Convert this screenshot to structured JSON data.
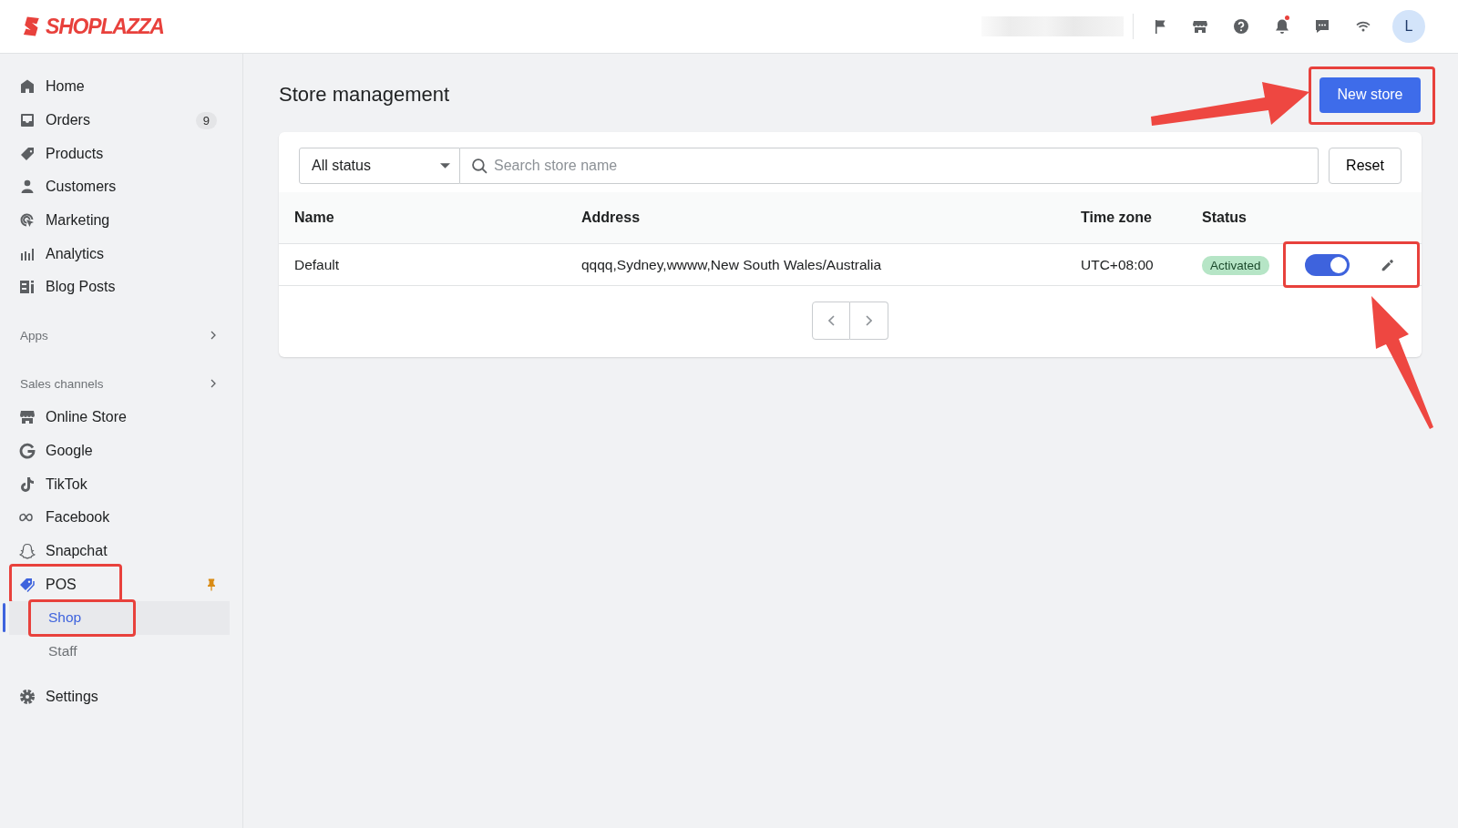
{
  "header": {
    "logo": "SHOPLAZZA",
    "avatar_initial": "L",
    "unread_notifications": true
  },
  "sidebar": {
    "items": [
      {
        "kind": "item",
        "label": "Home",
        "selected": false
      },
      {
        "kind": "item",
        "label": "Orders",
        "badge": "9",
        "selected": false
      },
      {
        "kind": "item",
        "label": "Products",
        "selected": false
      },
      {
        "kind": "item",
        "label": "Customers",
        "selected": false
      },
      {
        "kind": "item",
        "label": "Marketing",
        "selected": false
      },
      {
        "kind": "item",
        "label": "Analytics",
        "selected": false
      },
      {
        "kind": "item",
        "label": "Blog Posts",
        "selected": false
      },
      {
        "kind": "section",
        "label": "Apps"
      },
      {
        "kind": "section",
        "label": "Sales channels"
      },
      {
        "kind": "item",
        "label": "Online Store",
        "selected": false
      },
      {
        "kind": "item",
        "label": "Google",
        "selected": false
      },
      {
        "kind": "item",
        "label": "TikTok",
        "selected": false
      },
      {
        "kind": "item",
        "label": "Facebook",
        "selected": false
      },
      {
        "kind": "item",
        "label": "Snapchat",
        "selected": false
      },
      {
        "kind": "item",
        "label": "POS",
        "selected": false,
        "pinned": true,
        "annotated": true
      },
      {
        "kind": "subitem",
        "label": "Shop",
        "selected": true,
        "annotated": true
      },
      {
        "kind": "subitem",
        "label": "Staff",
        "selected": false
      },
      {
        "kind": "item",
        "label": "Settings",
        "selected": false,
        "gap": true
      }
    ]
  },
  "page": {
    "title": "Store management",
    "new_button": {
      "label": "New store",
      "annotated": true
    }
  },
  "filters": {
    "status": "All status",
    "search_placeholder": "Search store name",
    "reset": "Reset"
  },
  "table": {
    "columns": [
      "Name",
      "Address",
      "Time zone",
      "Status"
    ],
    "rows": [
      {
        "name": "Default",
        "address": "qqqq,Sydney,wwww,New South Wales/Australia",
        "time_zone": "UTC+08:00",
        "status": "Activated",
        "enabled": true,
        "annotated": true
      }
    ]
  }
}
